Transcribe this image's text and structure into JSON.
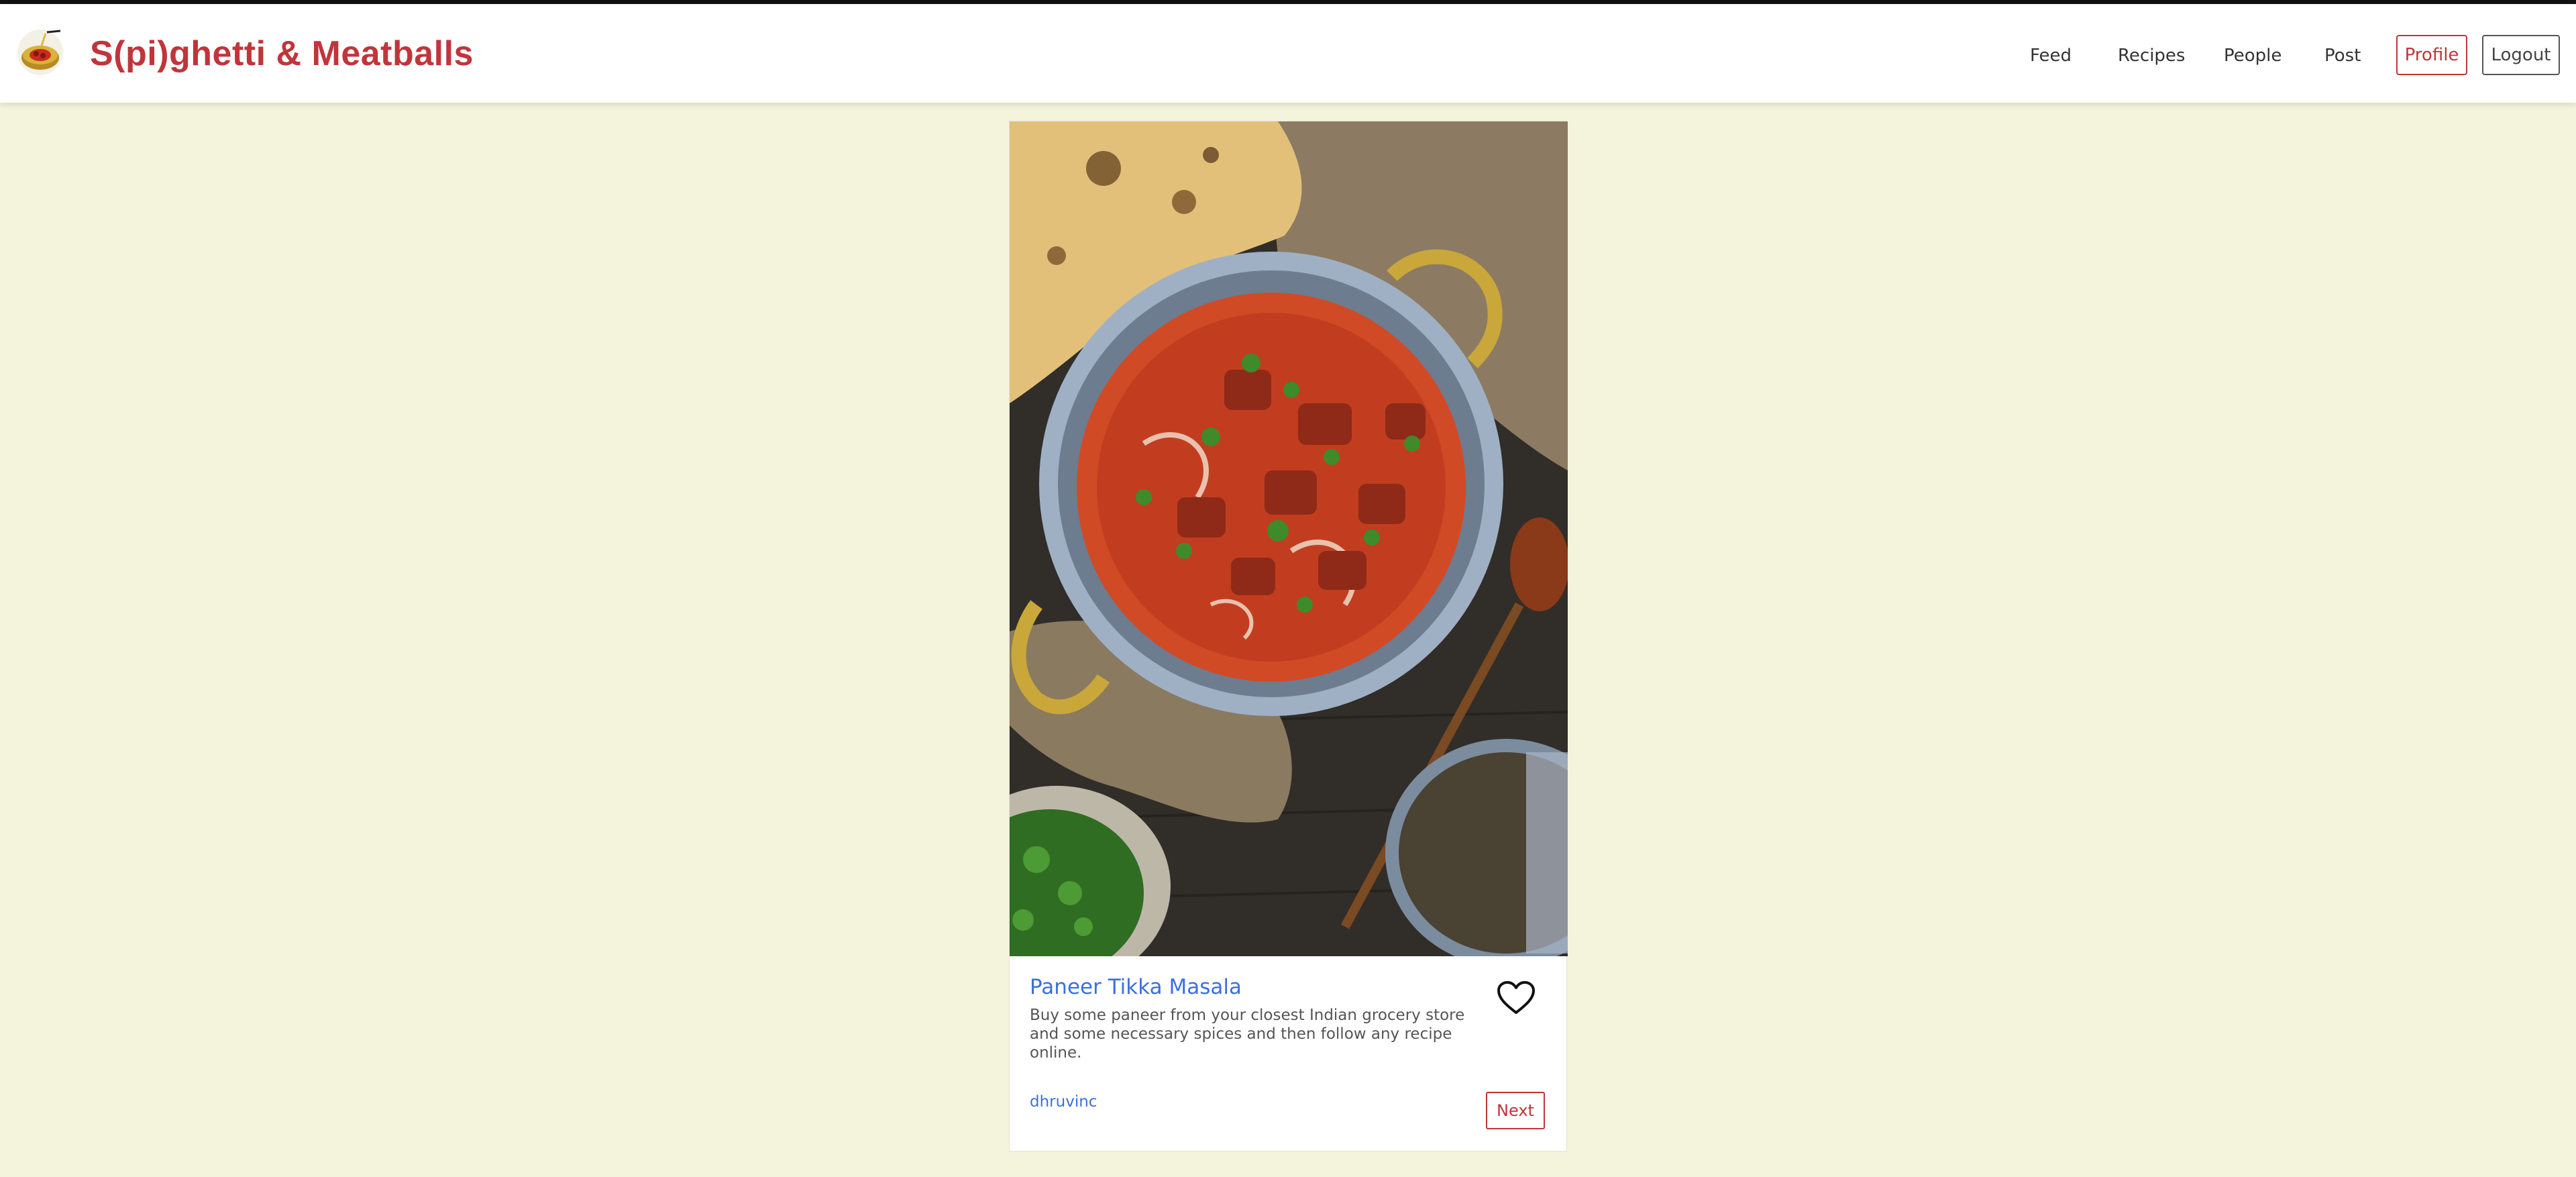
{
  "app": {
    "brand": "S(pi)ghetti & Meatballs",
    "logo_icon": "spaghetti-bowl-icon"
  },
  "nav": {
    "links": [
      "Feed",
      "Recipes",
      "People",
      "Post"
    ],
    "profile_label": "Profile",
    "logout_label": "Logout"
  },
  "post": {
    "image_icon": "tikka-masala-photo",
    "title": "Paneer Tikka Masala",
    "description": "Buy some paneer from your closest Indian grocery store and some necessary spices and then follow any recipe online.",
    "author": "dhruvinc",
    "like_icon": "heart-icon",
    "next_label": "Next"
  },
  "colors": {
    "accent": "#c0353b",
    "link": "#3b6fe0",
    "background": "#f4f4dc"
  }
}
